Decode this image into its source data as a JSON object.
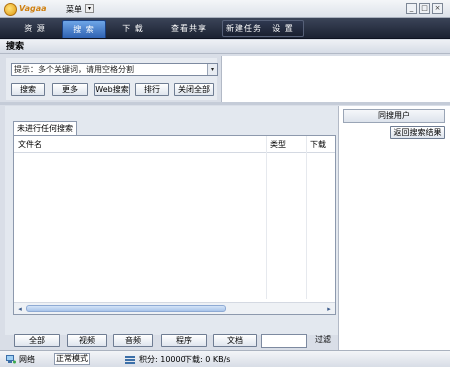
{
  "titlebar": {
    "logo_text": "Vagaa",
    "menu_label": "菜单",
    "menu_arrow": "▾",
    "minimize": "_",
    "maximize": "□",
    "close": "×"
  },
  "nav": {
    "tabs": [
      "资 源",
      "搜 索",
      "下 载",
      "查看共享",
      "新建任务",
      "设 置"
    ],
    "active": "搜 索"
  },
  "search": {
    "header": "搜索",
    "placeholder": "提示：多个关键词，请用空格分割",
    "dropdown_arrow": "▾",
    "buttons": [
      "搜索",
      "更多",
      "Web搜索",
      "排行",
      "关闭全部"
    ]
  },
  "results": {
    "tab_label": "未进行任何搜索",
    "columns": [
      "文件名",
      "类型",
      "下载"
    ],
    "scroll_left": "◂",
    "scroll_right": "▸",
    "filters": [
      "全部",
      "视频",
      "音频",
      "程序",
      "文档"
    ],
    "filter_value": "",
    "filter_button": "过滤"
  },
  "side": {
    "header": "同搜用户",
    "back_button": "返回搜索结果"
  },
  "status": {
    "network": "网络",
    "mode": "正常模式",
    "points": "积分: 10000",
    "download": "下载: 0 KB/s"
  }
}
